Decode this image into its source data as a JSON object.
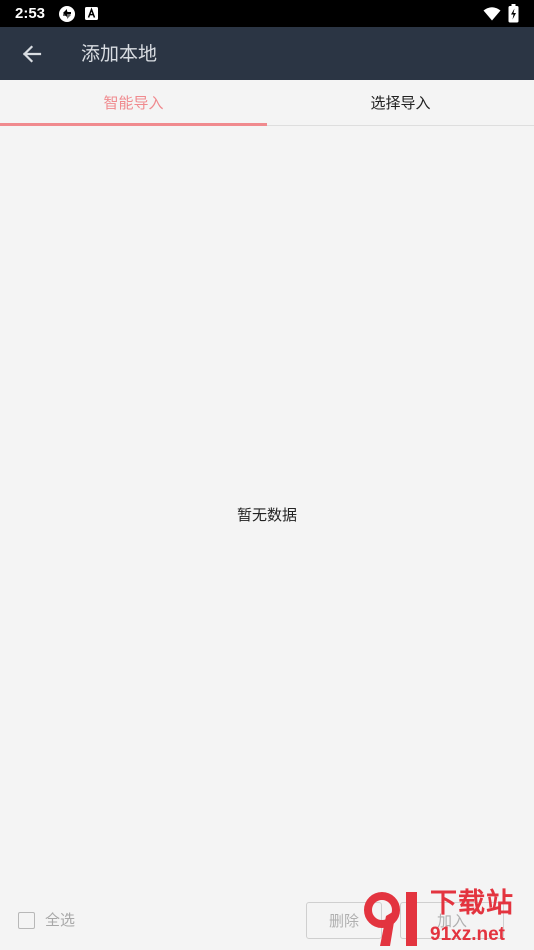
{
  "status_bar": {
    "time": "2:53",
    "icons": [
      "sync-icon",
      "keyboard-a-icon",
      "wifi-icon",
      "battery-charging-icon"
    ]
  },
  "app_bar": {
    "back_icon": "arrow-left-icon",
    "title": "添加本地"
  },
  "tabs": [
    {
      "label": "智能导入",
      "selected": true
    },
    {
      "label": "选择导入",
      "selected": false
    }
  ],
  "content": {
    "empty_text": "暂无数据"
  },
  "bottom_bar": {
    "select_all_label": "全选",
    "delete_label": "删除",
    "add_label": "加入"
  },
  "watermark": {
    "mark": "91",
    "cn_text": "下载站",
    "en_text": "91xz.net"
  },
  "colors": {
    "app_bar": "#2b3544",
    "accent": "#f08a8e",
    "background": "#f4f4f4",
    "watermark": "#e3343f"
  }
}
